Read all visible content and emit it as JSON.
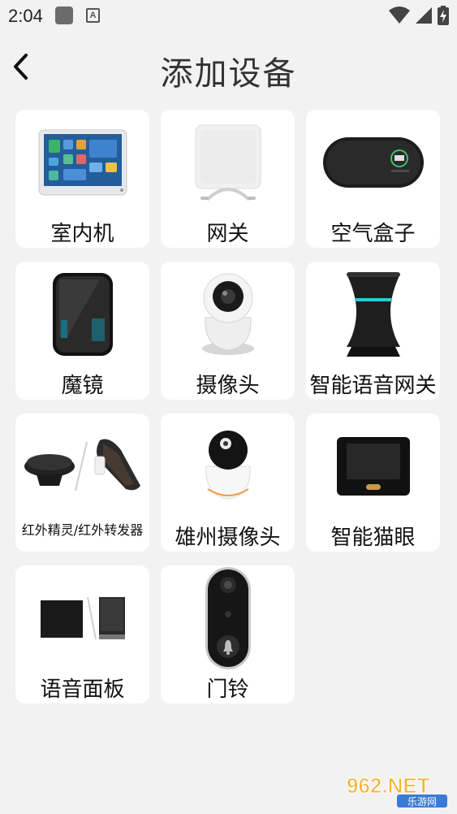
{
  "status": {
    "time": "2:04",
    "a_icon_letter": "A"
  },
  "header": {
    "title": "添加设备",
    "back_icon": "chevron-left-icon"
  },
  "devices": [
    {
      "label": "室内机",
      "icon": "indoor-unit-icon"
    },
    {
      "label": "网关",
      "icon": "gateway-icon"
    },
    {
      "label": "空气盒子",
      "icon": "air-box-icon"
    },
    {
      "label": "魔镜",
      "icon": "magic-mirror-icon"
    },
    {
      "label": "摄像头",
      "icon": "camera-icon"
    },
    {
      "label": "智能语音网关",
      "icon": "voice-gateway-icon"
    },
    {
      "label": "红外精灵/红外转发器",
      "icon": "ir-blaster-icon"
    },
    {
      "label": "雄州摄像头",
      "icon": "xiongzhou-camera-icon"
    },
    {
      "label": "智能猫眼",
      "icon": "smart-peephole-icon"
    },
    {
      "label": "语音面板",
      "icon": "voice-panel-icon"
    },
    {
      "label": "门铃",
      "icon": "doorbell-icon"
    }
  ],
  "watermark": {
    "text_top": "962.NET",
    "text_bottom": "乐游网"
  }
}
